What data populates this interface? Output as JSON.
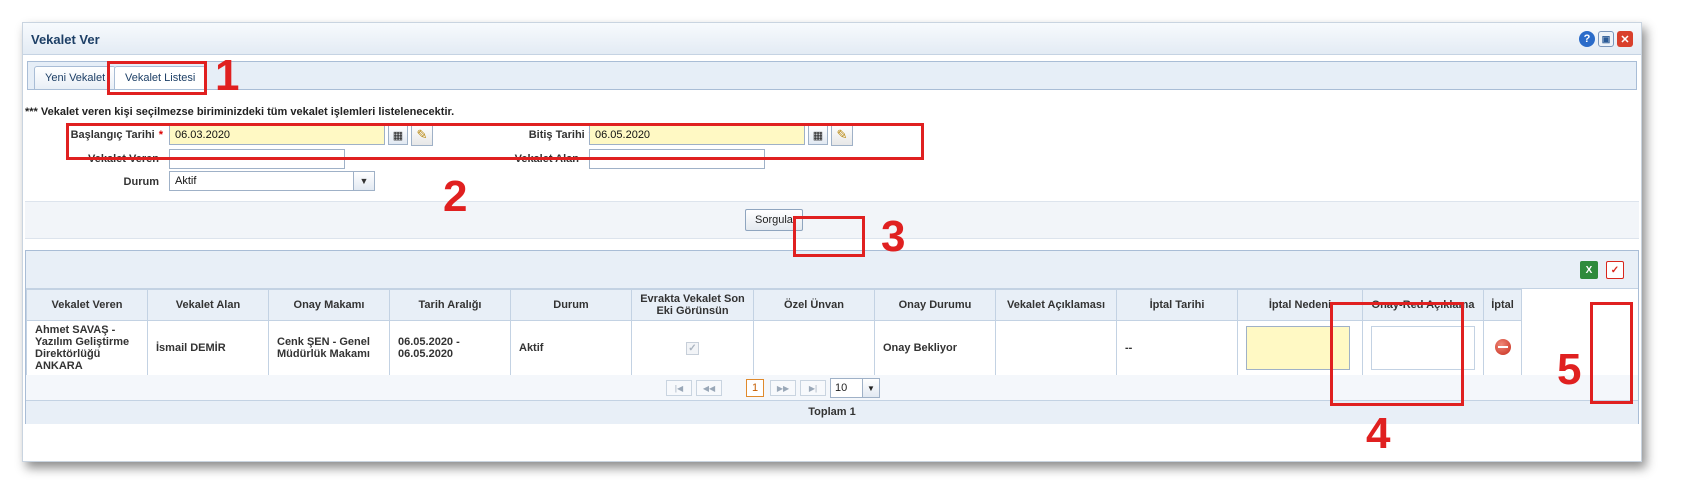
{
  "window": {
    "title": "Vekalet Ver"
  },
  "tabs": [
    {
      "label": "Yeni Vekalet"
    },
    {
      "label": "Vekalet Listesi"
    }
  ],
  "note": "*** Vekalet veren kişi seçilmezse biriminizdeki tüm vekalet işlemleri listelenecektir.",
  "form": {
    "start_date": {
      "label": "Başlangıç Tarihi",
      "required_mark": "*",
      "value": "06.03.2020"
    },
    "end_date": {
      "label": "Bitiş Tarihi",
      "required_mark": "*",
      "value": "06.05.2020"
    },
    "grantor": {
      "label": "Vekalet Veren",
      "value": ""
    },
    "grantee": {
      "label": "Vekalet Alan",
      "value": ""
    },
    "status": {
      "label": "Durum",
      "value": "Aktif"
    }
  },
  "query_button": "Sorgula",
  "table": {
    "columns": [
      "Vekalet Veren",
      "Vekalet Alan",
      "Onay Makamı",
      "Tarih Aralığı",
      "Durum",
      "Evrakta Vekalet Son Eki Görünsün",
      "Özel Ünvan",
      "Onay Durumu",
      "Vekalet Açıklaması",
      "İptal Tarihi",
      "İptal Nedeni",
      "Onay-Red Açıklama",
      "İptal"
    ],
    "rows": [
      {
        "grantor": "Ahmet SAVAŞ - Yazılım Geliştirme Direktörlüğü ANKARA",
        "grantee": "İsmail DEMİR",
        "approver": "Cenk ŞEN - Genel Müdürlük Makamı",
        "date_range": "06.05.2020 - 06.05.2020",
        "status": "Aktif",
        "suffix_checked": true,
        "special_title": "",
        "approval_status": "Onay Bekliyor",
        "description": "",
        "cancel_date": "--",
        "cancel_reason": "",
        "approve_note": ""
      }
    ]
  },
  "pager": {
    "current_page": "1",
    "page_size": "10"
  },
  "total": "Toplam 1",
  "annotations": [
    "1",
    "2",
    "3",
    "4",
    "5"
  ],
  "colors": {
    "annotation": "#e02020",
    "required_field": "#fff9c4"
  }
}
